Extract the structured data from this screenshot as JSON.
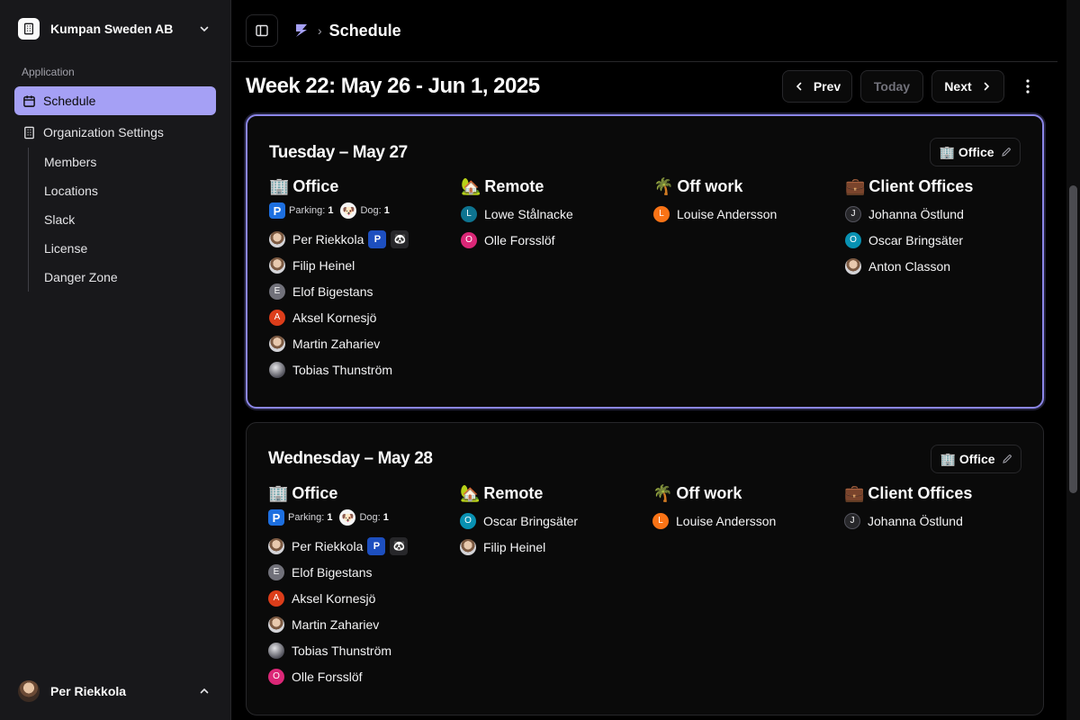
{
  "org": {
    "name": "Kumpan Sweden AB"
  },
  "sidebar": {
    "group_label": "Application",
    "items": [
      {
        "label": "Schedule",
        "icon": "calendar-icon",
        "active": true
      },
      {
        "label": "Organization Settings",
        "icon": "building-icon",
        "active": false
      }
    ],
    "sub_items": [
      "Members",
      "Locations",
      "Slack",
      "License",
      "Danger Zone"
    ],
    "user": {
      "name": "Per Riekkola"
    }
  },
  "header": {
    "title": "Schedule"
  },
  "week": {
    "title": "Week 22: May 26 - Jun 1, 2025",
    "prev_label": "Prev",
    "today_label": "Today",
    "next_label": "Next"
  },
  "colors": {
    "accent": "#a5a0f5",
    "selected_border": "#8b86e8",
    "parking": "#1d6fe0"
  },
  "days": [
    {
      "title": "Tuesday – May 27",
      "location_button": "Office",
      "columns": [
        {
          "emoji": "🏢",
          "title": "Office",
          "parking_label": "Parking:",
          "parking": "1",
          "dog_label": "Dog:",
          "dog": "1",
          "people": [
            {
              "name": "Per Riekkola",
              "avatar": "photo",
              "parking": true,
              "dog": true
            },
            {
              "name": "Filip Heinel",
              "avatar": "photo"
            },
            {
              "name": "Elof Bigestans",
              "avatar": "E",
              "color": "#71717a"
            },
            {
              "name": "Aksel Kornesjö",
              "avatar": "A",
              "color": "#dc3d1a"
            },
            {
              "name": "Martin Zahariev",
              "avatar": "photo"
            },
            {
              "name": "Tobias Thunström",
              "avatar": "grey"
            }
          ]
        },
        {
          "emoji": "🏡",
          "title": "Remote",
          "people": [
            {
              "name": "Lowe Stålnacke",
              "avatar": "L",
              "color": "#0e7490"
            },
            {
              "name": "Olle Forsslöf",
              "avatar": "O",
              "color": "#db2777"
            }
          ]
        },
        {
          "emoji": "🌴",
          "title": "Off work",
          "people": [
            {
              "name": "Louise Andersson",
              "avatar": "L",
              "color": "#f97316"
            }
          ]
        },
        {
          "emoji": "💼",
          "title": "Client Offices",
          "people": [
            {
              "name": "Johanna Östlund",
              "avatar": "J",
              "color": "#27272a"
            },
            {
              "name": "Oscar Bringsäter",
              "avatar": "O",
              "color": "#0891b2"
            },
            {
              "name": "Anton Classon",
              "avatar": "photo"
            }
          ]
        }
      ]
    },
    {
      "title": "Wednesday – May 28",
      "location_button": "Office",
      "columns": [
        {
          "emoji": "🏢",
          "title": "Office",
          "parking_label": "Parking:",
          "parking": "1",
          "dog_label": "Dog:",
          "dog": "1",
          "people": [
            {
              "name": "Per Riekkola",
              "avatar": "photo",
              "parking": true,
              "dog": true
            },
            {
              "name": "Elof Bigestans",
              "avatar": "E",
              "color": "#71717a"
            },
            {
              "name": "Aksel Kornesjö",
              "avatar": "A",
              "color": "#dc3d1a"
            },
            {
              "name": "Martin Zahariev",
              "avatar": "photo"
            },
            {
              "name": "Tobias Thunström",
              "avatar": "grey"
            },
            {
              "name": "Olle Forsslöf",
              "avatar": "O",
              "color": "#db2777"
            }
          ]
        },
        {
          "emoji": "🏡",
          "title": "Remote",
          "people": [
            {
              "name": "Oscar Bringsäter",
              "avatar": "O",
              "color": "#0891b2"
            },
            {
              "name": "Filip Heinel",
              "avatar": "photo"
            }
          ]
        },
        {
          "emoji": "🌴",
          "title": "Off work",
          "people": [
            {
              "name": "Louise Andersson",
              "avatar": "L",
              "color": "#f97316"
            }
          ]
        },
        {
          "emoji": "💼",
          "title": "Client Offices",
          "people": [
            {
              "name": "Johanna Östlund",
              "avatar": "J",
              "color": "#27272a"
            }
          ]
        }
      ]
    }
  ]
}
